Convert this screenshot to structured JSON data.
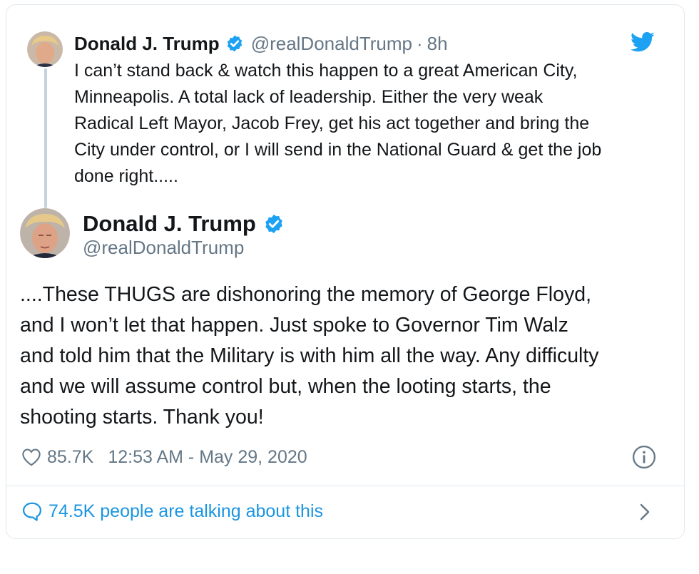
{
  "parent_tweet": {
    "name": "Donald J. Trump",
    "handle": "@realDonaldTrump",
    "separator": "·",
    "time": "8h",
    "text": "I can’t stand back & watch this happen to a great American City,\nMinneapolis. A total lack of leadership. Either the very weak\nRadical Left Mayor, Jacob Frey, get his act together and bring the\nCity under control, or I will send in the National Guard & get the job\ndone right....."
  },
  "main_tweet": {
    "name": "Donald J. Trump",
    "handle": "@realDonaldTrump",
    "text": "....These THUGS are dishonoring the memory of George Floyd,\nand I won’t let that happen. Just spoke to Governor Tim Walz\nand told him that the Military is with him all the way. Any difficulty\nand we will assume control but, when the looting starts, the\nshooting starts. Thank you!",
    "likes": "85.7K",
    "timestamp": "12:53 AM - May 29, 2020"
  },
  "footer": {
    "talking_label": "74.5K people are talking about this"
  },
  "icons": {
    "verified": "verified-badge-icon",
    "twitter": "twitter-bird-icon",
    "heart": "heart-icon",
    "info": "info-icon",
    "comment": "speech-bubble-icon",
    "chevron": "chevron-right-icon"
  },
  "colors": {
    "accent": "#1da1f2",
    "link": "#1b95e0",
    "secondary_text": "#657786",
    "border": "#e1e8ed"
  }
}
